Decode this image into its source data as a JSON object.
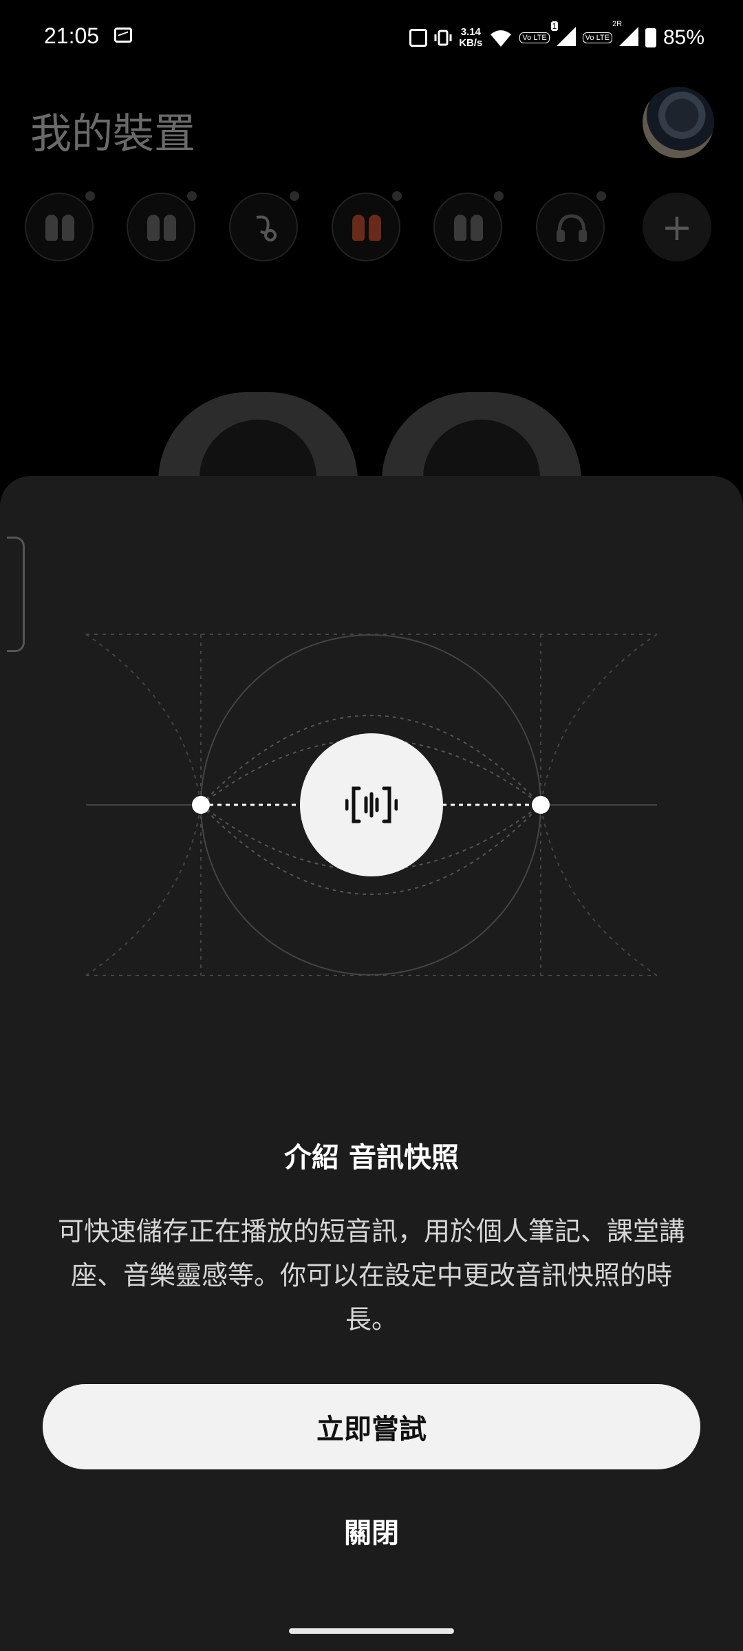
{
  "status_bar": {
    "time": "21:05",
    "net_speed_value": "3.14",
    "net_speed_unit": "KB/s",
    "sim1_badge": "1",
    "sim2_badge": "2R",
    "volte_label": "Vo",
    "lte_label": "LTE",
    "battery": "85%"
  },
  "app": {
    "title": "我的裝置"
  },
  "devices": [
    {
      "icon": "earbuds-icon"
    },
    {
      "icon": "earbuds-icon"
    },
    {
      "icon": "open-earbuds-icon"
    },
    {
      "icon": "earbuds-red-icon"
    },
    {
      "icon": "earbuds-icon"
    },
    {
      "icon": "headphones-icon"
    }
  ],
  "add_device_label": "+",
  "sheet": {
    "title": "介紹 音訊快照",
    "description": "可快速儲存正在播放的短音訊，用於個人筆記、課堂講座、音樂靈感等。你可以在設定中更改音訊快照的時長。",
    "primary_button": "立即嘗試",
    "secondary_button": "關閉",
    "icon": "audio-snapshot-icon"
  },
  "colors": {
    "sheet_bg": "#1c1c1c",
    "button_bg": "#f2f2f2"
  }
}
